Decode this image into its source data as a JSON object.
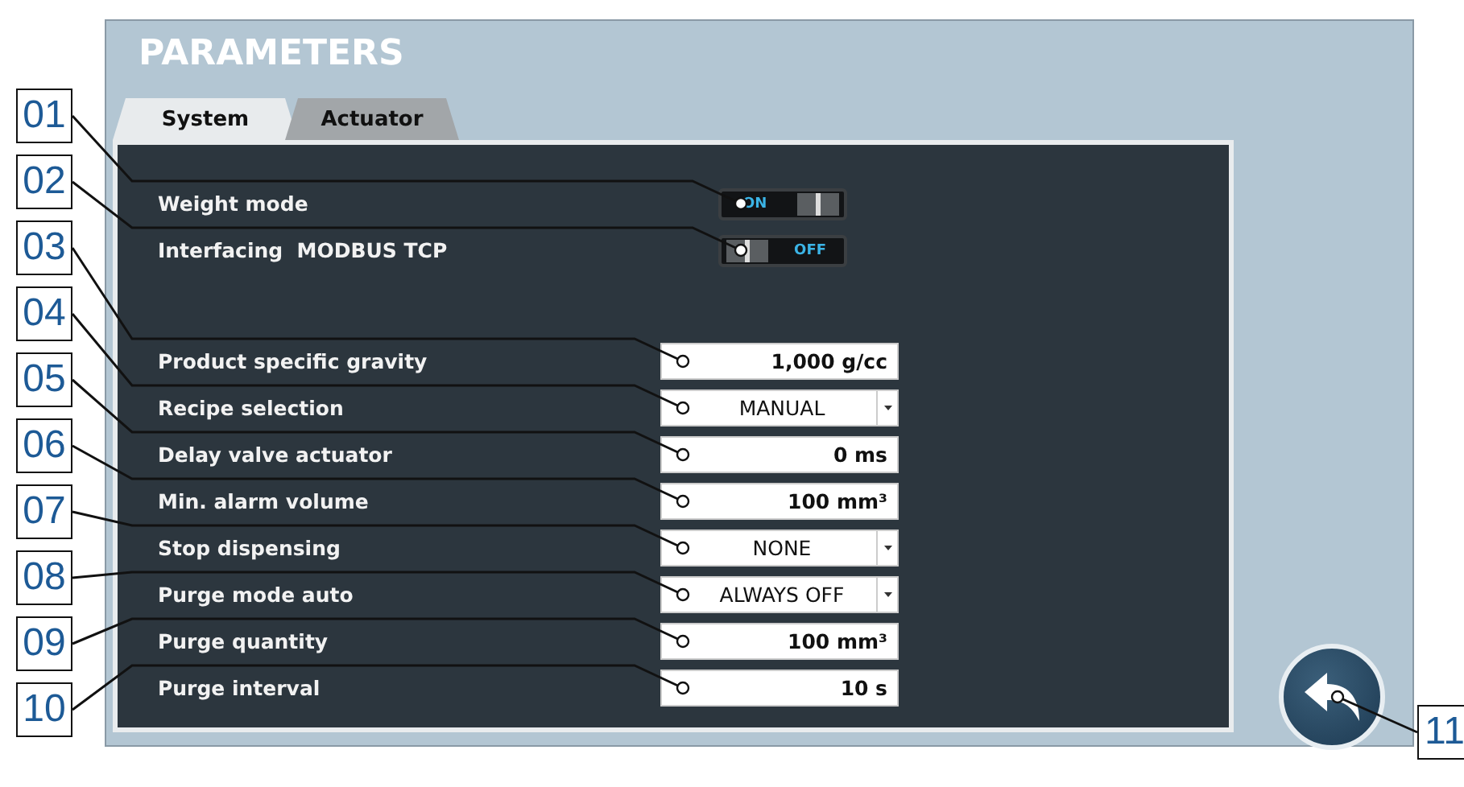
{
  "title": "PARAMETERS",
  "tabs": [
    {
      "label": "System",
      "selected": true
    },
    {
      "label": "Actuator",
      "selected": false
    }
  ],
  "switches": [
    {
      "label": "Weight mode",
      "on": true,
      "switch_text": "ON"
    },
    {
      "label": "Interfacing  MODBUS TCP",
      "on": false,
      "switch_text": "OFF"
    }
  ],
  "fields": [
    {
      "label": "Product specific gravity",
      "kind": "input",
      "value": "1,000 g/cc"
    },
    {
      "label": "Recipe selection",
      "kind": "dropdown",
      "value": "MANUAL"
    },
    {
      "label": "Delay valve actuator",
      "kind": "input",
      "value": "0 ms"
    },
    {
      "label": "Min. alarm volume",
      "kind": "input",
      "value": "100 mm³"
    },
    {
      "label": "Stop dispensing",
      "kind": "dropdown",
      "value": "NONE"
    },
    {
      "label": "Purge mode auto",
      "kind": "dropdown",
      "value": "ALWAYS OFF"
    },
    {
      "label": "Purge quantity",
      "kind": "input",
      "value": "100 mm³"
    },
    {
      "label": "Purge interval",
      "kind": "input",
      "value": "10 s"
    }
  ],
  "callouts": [
    "01",
    "02",
    "03",
    "04",
    "05",
    "06",
    "07",
    "08",
    "09",
    "10",
    "11"
  ]
}
